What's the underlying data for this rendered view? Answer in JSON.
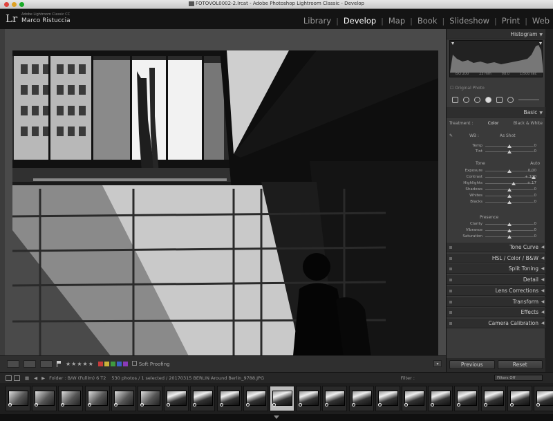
{
  "window": {
    "title": "FOTOVOL0002-2.lrcat - Adobe Photoshop Lightroom Classic - Develop"
  },
  "identity": {
    "logo": "Lr",
    "sub": "Adobe Lightroom Classic CC",
    "name": "Marco Ristuccia"
  },
  "modules": [
    {
      "label": "Library",
      "active": false
    },
    {
      "label": "Develop",
      "active": true
    },
    {
      "label": "Map",
      "active": false
    },
    {
      "label": "Book",
      "active": false
    },
    {
      "label": "Slideshow",
      "active": false
    },
    {
      "label": "Print",
      "active": false
    },
    {
      "label": "Web",
      "active": false
    }
  ],
  "histogram": {
    "title": "Histogram",
    "info": [
      "ISO 200",
      "23 mm",
      "f/8.0",
      "1/500 sec"
    ],
    "original_photo": "Original Photo"
  },
  "basic": {
    "title": "Basic",
    "treatment_label": "Treatment :",
    "treatment_options": [
      "Color",
      "Black & White"
    ],
    "wb_label": "WB :",
    "wb_value": "As Shot",
    "tone_label": "Tone",
    "auto_label": "Auto",
    "presence_label": "Presence",
    "sliders_wb": [
      {
        "label": "Temp",
        "value": "0",
        "pos": 0.5
      },
      {
        "label": "Tint",
        "value": "0",
        "pos": 0.5
      }
    ],
    "sliders_tone": [
      {
        "label": "Exposure",
        "value": "0,00",
        "pos": 0.5
      },
      {
        "label": "Contrast",
        "value": "+ 100",
        "pos": 1.0
      },
      {
        "label": "Highlights",
        "value": "+ 17",
        "pos": 0.58
      },
      {
        "label": "Shadows",
        "value": "0",
        "pos": 0.5
      },
      {
        "label": "Whites",
        "value": "0",
        "pos": 0.5
      },
      {
        "label": "Blacks",
        "value": "0",
        "pos": 0.5
      }
    ],
    "sliders_presence": [
      {
        "label": "Clarity",
        "value": "0",
        "pos": 0.5
      },
      {
        "label": "Vibrance",
        "value": "0",
        "pos": 0.5
      },
      {
        "label": "Saturation",
        "value": "0",
        "pos": 0.5
      }
    ]
  },
  "collapsed_panels": [
    "Tone Curve",
    "HSL / Color / B&W",
    "Split Toning",
    "Detail",
    "Lens Corrections",
    "Transform",
    "Effects",
    "Camera Calibration"
  ],
  "buttons": {
    "previous": "Previous",
    "reset": "Reset"
  },
  "toolbar": {
    "stars": "★★★★★",
    "soft_proofing": "Soft Proofing",
    "color_labels": [
      "#c43b3b",
      "#c9b23a",
      "#3f9a3f",
      "#3a62c4",
      "#8a3ab9"
    ]
  },
  "filmbar": {
    "page1": "1",
    "page2": "2",
    "source": "Folder : B/W (Fulllm) 6 T2",
    "count": "530 photos / 1 selected / 20170315 BERLIN Around Berlin_9788.JPG",
    "filter_label": "Filter :",
    "filters_off": "Filters Off"
  },
  "filmstrip": {
    "count": 21,
    "selected_index": 10
  }
}
